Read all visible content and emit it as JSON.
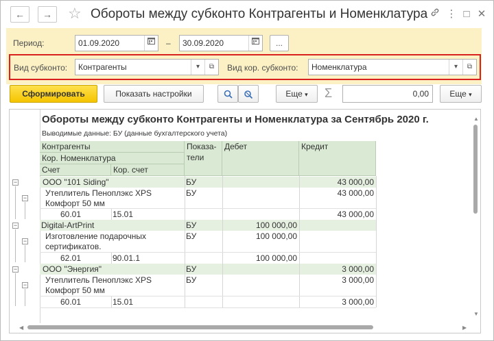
{
  "window": {
    "title": "Обороты между субконто Контрагенты и Номенклатура",
    "back_icon": "←",
    "forward_icon": "→",
    "star_icon": "☆",
    "link_icon": "🔗",
    "menu_icon": "⋮",
    "maximize_icon": "□",
    "close_icon": "✕"
  },
  "period": {
    "label": "Период:",
    "from": "01.09.2020",
    "dash": "–",
    "to": "30.09.2020",
    "more_label": "..."
  },
  "subkonto": {
    "label": "Вид субконто:",
    "value": "Контрагенты",
    "kor_label": "Вид кор. субконто:",
    "kor_value": "Номенклатура"
  },
  "toolbar": {
    "generate_label": "Сформировать",
    "settings_label": "Показать настройки",
    "more_label": "Еще",
    "sum_value": "0,00",
    "more2_label": "Еще"
  },
  "report": {
    "title": "Обороты между субконто Контрагенты и Номенклатура за Сентябрь 2020 г.",
    "subtitle": "Выводимые данные:  БУ (данные бухгалтерского учета)",
    "headers": {
      "kontragenty": "Контрагенты",
      "kor_nomenklatura": "Кор. Номенклатура",
      "schet": "Счет",
      "kor_schet": "Кор. счет",
      "pokazateli_1": "Показа-",
      "pokazateli_2": "тели",
      "debet": "Дебет",
      "kredit": "Кредит"
    },
    "rows": [
      {
        "name": "ООО \"101 Siding\"",
        "ind": "БУ",
        "debet": "",
        "kredit": "43 000,00"
      },
      {
        "name": "Утеплитель Пеноплэкс XPS",
        "name2": "Комфорт 50 мм",
        "ind": "БУ",
        "debet": "",
        "kredit": "43 000,00"
      },
      {
        "schet": "60.01",
        "kor": "15.01",
        "debet": "",
        "kredit": "43 000,00"
      },
      {
        "name": "Digital-ArtPrint",
        "ind": "БУ",
        "debet": "100 000,00",
        "kredit": ""
      },
      {
        "name": "Изготовление подарочных",
        "name2": "сертификатов.",
        "ind": "БУ",
        "debet": "100 000,00",
        "kredit": ""
      },
      {
        "schet": "62.01",
        "kor": "90.01.1",
        "debet": "100 000,00",
        "kredit": ""
      },
      {
        "name": "ООО \"Энергия\"",
        "ind": "БУ",
        "debet": "",
        "kredit": "3 000,00"
      },
      {
        "name": "Утеплитель Пеноплэкс XPS",
        "name2": "Комфорт 50 мм",
        "ind": "БУ",
        "debet": "",
        "kredit": "3 000,00"
      },
      {
        "schet": "60.01",
        "kor": "15.01",
        "debet": "",
        "kredit": "3 000,00"
      }
    ]
  }
}
